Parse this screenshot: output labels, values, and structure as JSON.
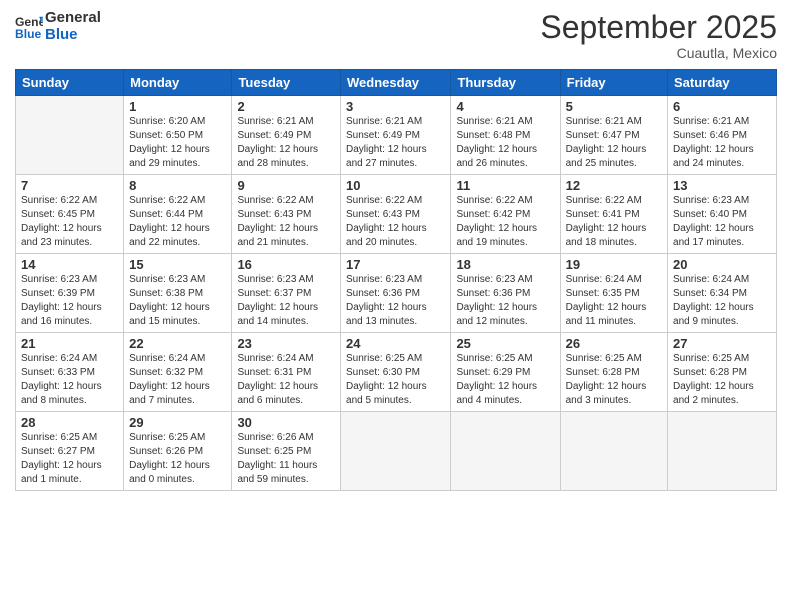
{
  "header": {
    "logo_general": "General",
    "logo_blue": "Blue",
    "month": "September 2025",
    "location": "Cuautla, Mexico"
  },
  "weekdays": [
    "Sunday",
    "Monday",
    "Tuesday",
    "Wednesday",
    "Thursday",
    "Friday",
    "Saturday"
  ],
  "weeks": [
    [
      {
        "day": "",
        "info": ""
      },
      {
        "day": "1",
        "info": "Sunrise: 6:20 AM\nSunset: 6:50 PM\nDaylight: 12 hours\nand 29 minutes."
      },
      {
        "day": "2",
        "info": "Sunrise: 6:21 AM\nSunset: 6:49 PM\nDaylight: 12 hours\nand 28 minutes."
      },
      {
        "day": "3",
        "info": "Sunrise: 6:21 AM\nSunset: 6:49 PM\nDaylight: 12 hours\nand 27 minutes."
      },
      {
        "day": "4",
        "info": "Sunrise: 6:21 AM\nSunset: 6:48 PM\nDaylight: 12 hours\nand 26 minutes."
      },
      {
        "day": "5",
        "info": "Sunrise: 6:21 AM\nSunset: 6:47 PM\nDaylight: 12 hours\nand 25 minutes."
      },
      {
        "day": "6",
        "info": "Sunrise: 6:21 AM\nSunset: 6:46 PM\nDaylight: 12 hours\nand 24 minutes."
      }
    ],
    [
      {
        "day": "7",
        "info": "Sunrise: 6:22 AM\nSunset: 6:45 PM\nDaylight: 12 hours\nand 23 minutes."
      },
      {
        "day": "8",
        "info": "Sunrise: 6:22 AM\nSunset: 6:44 PM\nDaylight: 12 hours\nand 22 minutes."
      },
      {
        "day": "9",
        "info": "Sunrise: 6:22 AM\nSunset: 6:43 PM\nDaylight: 12 hours\nand 21 minutes."
      },
      {
        "day": "10",
        "info": "Sunrise: 6:22 AM\nSunset: 6:43 PM\nDaylight: 12 hours\nand 20 minutes."
      },
      {
        "day": "11",
        "info": "Sunrise: 6:22 AM\nSunset: 6:42 PM\nDaylight: 12 hours\nand 19 minutes."
      },
      {
        "day": "12",
        "info": "Sunrise: 6:22 AM\nSunset: 6:41 PM\nDaylight: 12 hours\nand 18 minutes."
      },
      {
        "day": "13",
        "info": "Sunrise: 6:23 AM\nSunset: 6:40 PM\nDaylight: 12 hours\nand 17 minutes."
      }
    ],
    [
      {
        "day": "14",
        "info": "Sunrise: 6:23 AM\nSunset: 6:39 PM\nDaylight: 12 hours\nand 16 minutes."
      },
      {
        "day": "15",
        "info": "Sunrise: 6:23 AM\nSunset: 6:38 PM\nDaylight: 12 hours\nand 15 minutes."
      },
      {
        "day": "16",
        "info": "Sunrise: 6:23 AM\nSunset: 6:37 PM\nDaylight: 12 hours\nand 14 minutes."
      },
      {
        "day": "17",
        "info": "Sunrise: 6:23 AM\nSunset: 6:36 PM\nDaylight: 12 hours\nand 13 minutes."
      },
      {
        "day": "18",
        "info": "Sunrise: 6:23 AM\nSunset: 6:36 PM\nDaylight: 12 hours\nand 12 minutes."
      },
      {
        "day": "19",
        "info": "Sunrise: 6:24 AM\nSunset: 6:35 PM\nDaylight: 12 hours\nand 11 minutes."
      },
      {
        "day": "20",
        "info": "Sunrise: 6:24 AM\nSunset: 6:34 PM\nDaylight: 12 hours\nand 9 minutes."
      }
    ],
    [
      {
        "day": "21",
        "info": "Sunrise: 6:24 AM\nSunset: 6:33 PM\nDaylight: 12 hours\nand 8 minutes."
      },
      {
        "day": "22",
        "info": "Sunrise: 6:24 AM\nSunset: 6:32 PM\nDaylight: 12 hours\nand 7 minutes."
      },
      {
        "day": "23",
        "info": "Sunrise: 6:24 AM\nSunset: 6:31 PM\nDaylight: 12 hours\nand 6 minutes."
      },
      {
        "day": "24",
        "info": "Sunrise: 6:25 AM\nSunset: 6:30 PM\nDaylight: 12 hours\nand 5 minutes."
      },
      {
        "day": "25",
        "info": "Sunrise: 6:25 AM\nSunset: 6:29 PM\nDaylight: 12 hours\nand 4 minutes."
      },
      {
        "day": "26",
        "info": "Sunrise: 6:25 AM\nSunset: 6:28 PM\nDaylight: 12 hours\nand 3 minutes."
      },
      {
        "day": "27",
        "info": "Sunrise: 6:25 AM\nSunset: 6:28 PM\nDaylight: 12 hours\nand 2 minutes."
      }
    ],
    [
      {
        "day": "28",
        "info": "Sunrise: 6:25 AM\nSunset: 6:27 PM\nDaylight: 12 hours\nand 1 minute."
      },
      {
        "day": "29",
        "info": "Sunrise: 6:25 AM\nSunset: 6:26 PM\nDaylight: 12 hours\nand 0 minutes."
      },
      {
        "day": "30",
        "info": "Sunrise: 6:26 AM\nSunset: 6:25 PM\nDaylight: 11 hours\nand 59 minutes."
      },
      {
        "day": "",
        "info": ""
      },
      {
        "day": "",
        "info": ""
      },
      {
        "day": "",
        "info": ""
      },
      {
        "day": "",
        "info": ""
      }
    ]
  ]
}
